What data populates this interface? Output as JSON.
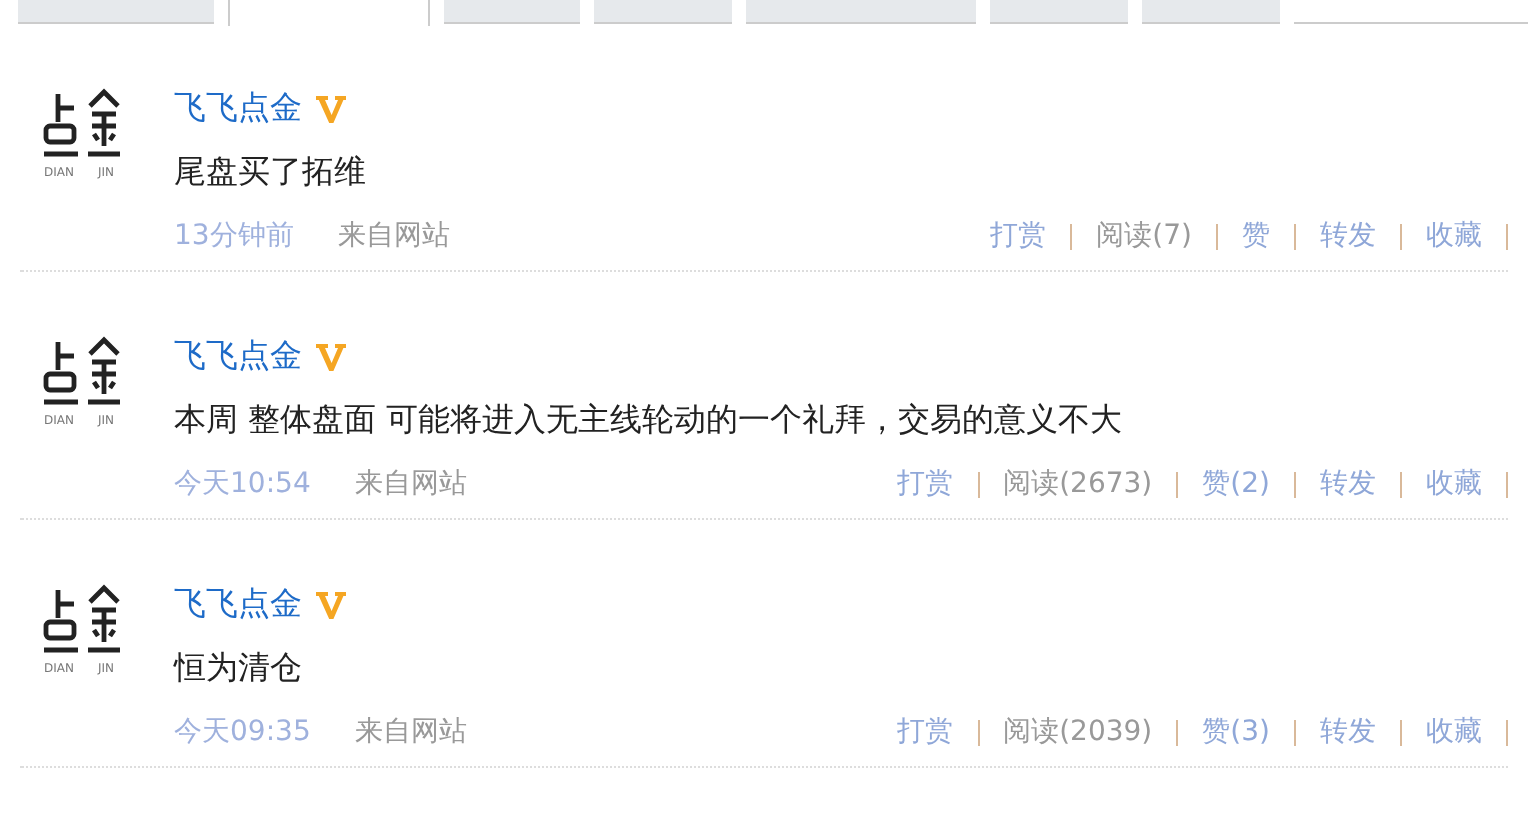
{
  "tabs": [
    {
      "selected": false
    },
    {
      "selected": true
    },
    {
      "selected": false
    },
    {
      "selected": false
    },
    {
      "selected": false
    },
    {
      "selected": false
    },
    {
      "selected": false
    }
  ],
  "posts": [
    {
      "logo_text": [
        "DIAN",
        "JIN"
      ],
      "author": "飞飞点金",
      "verified": true,
      "text": "尾盘买了拓维",
      "time": "13分钟前",
      "source": "来自网站",
      "actions": [
        {
          "label": "打赏",
          "kind": "link"
        },
        {
          "label": "阅读(7)",
          "kind": "count"
        },
        {
          "label": "赞",
          "kind": "link"
        },
        {
          "label": "转发",
          "kind": "link"
        },
        {
          "label": "收藏",
          "kind": "link"
        }
      ]
    },
    {
      "logo_text": [
        "DIAN",
        "JIN"
      ],
      "author": "飞飞点金",
      "verified": true,
      "text": "本周 整体盘面 可能将进入无主线轮动的一个礼拜，交易的意义不大",
      "time": "今天10:54",
      "source": "来自网站",
      "actions": [
        {
          "label": "打赏",
          "kind": "link"
        },
        {
          "label": "阅读(2673)",
          "kind": "count"
        },
        {
          "label": "赞(2)",
          "kind": "link"
        },
        {
          "label": "转发",
          "kind": "link"
        },
        {
          "label": "收藏",
          "kind": "link"
        }
      ]
    },
    {
      "logo_text": [
        "DIAN",
        "JIN"
      ],
      "author": "飞飞点金",
      "verified": true,
      "text": "恒为清仓",
      "time": "今天09:35",
      "source": "来自网站",
      "actions": [
        {
          "label": "打赏",
          "kind": "link"
        },
        {
          "label": "阅读(2039)",
          "kind": "count"
        },
        {
          "label": "赞(3)",
          "kind": "link"
        },
        {
          "label": "转发",
          "kind": "link"
        },
        {
          "label": "收藏",
          "kind": "link"
        }
      ]
    }
  ]
}
